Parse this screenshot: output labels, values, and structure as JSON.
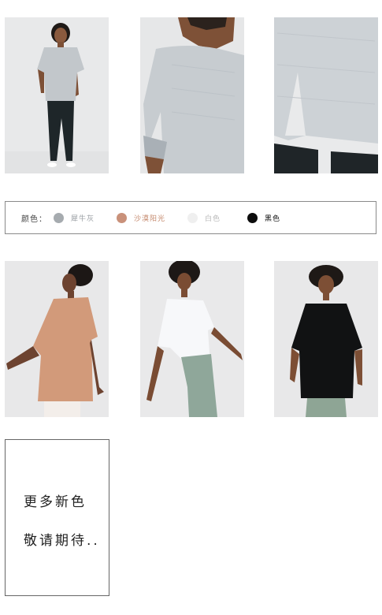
{
  "colors": {
    "label": "颜色：",
    "items": [
      {
        "name": "犀牛灰",
        "dot": "#a6abaf",
        "text": "#9a9fa4"
      },
      {
        "name": "沙漠阳光",
        "dot": "#c9917a",
        "text": "#c58a6e"
      },
      {
        "name": "白色",
        "dot": "#efefef",
        "text": "#b9b9b9"
      },
      {
        "name": "黑色",
        "dot": "#0c0c0c",
        "text": "#111111"
      }
    ]
  },
  "notice": {
    "line1": "更多新色",
    "line2": "敬请期待.."
  }
}
